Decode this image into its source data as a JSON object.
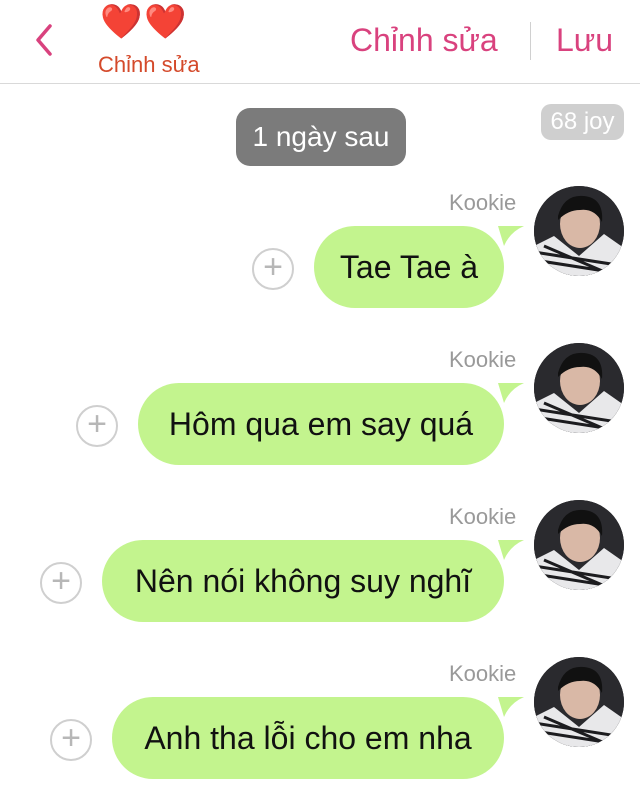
{
  "header": {
    "hearts": [
      "❤️",
      "❤️"
    ],
    "subtitle": "Chỉnh sửa",
    "edit_label": "Chỉnh sửa",
    "save_label": "Lưu",
    "accent_color": "#d9427e"
  },
  "date_marker": "1 ngày sau",
  "counter": "68 joy",
  "messages": [
    {
      "sender": "Kookie",
      "text": "Tae Tae à"
    },
    {
      "sender": "Kookie",
      "text": "Hôm qua em say quá"
    },
    {
      "sender": "Kookie",
      "text": "Nên nói không suy nghĩ"
    },
    {
      "sender": "Kookie",
      "text": "Anh tha lỗi cho em nha"
    }
  ],
  "colors": {
    "bubble": "#c3f48e",
    "date_pill": "#7b7b7b",
    "counter": "#cfcfcf"
  }
}
